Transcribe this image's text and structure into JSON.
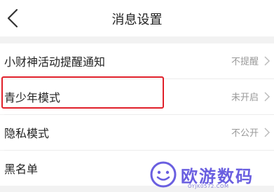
{
  "header": {
    "title": "消息设置"
  },
  "settings": [
    {
      "label": "小财神活动提醒通知",
      "value": "不提醒"
    },
    {
      "label": "青少年模式",
      "value": "未开启"
    },
    {
      "label": "隐私模式",
      "value": "不公开"
    },
    {
      "label": "黑名单",
      "value": ""
    }
  ],
  "watermark": {
    "name": "欧游数码",
    "url": "OYJK0572.COM"
  },
  "colors": {
    "highlight": "#e0202a",
    "watermark": "#6a5fe0"
  }
}
